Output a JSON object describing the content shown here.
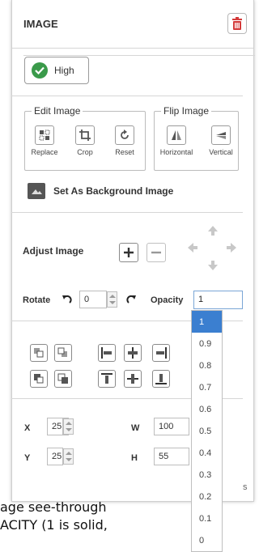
{
  "panel": {
    "title": "IMAGE",
    "delete_icon": "trash-icon"
  },
  "quality": {
    "label": "High",
    "icon": "check-circle-icon",
    "accent": "#3a9a4a"
  },
  "edit_image": {
    "legend": "Edit Image",
    "tools": [
      {
        "label": "Replace",
        "icon": "replace-icon"
      },
      {
        "label": "Crop",
        "icon": "crop-icon"
      },
      {
        "label": "Reset",
        "icon": "reset-icon"
      }
    ]
  },
  "flip_image": {
    "legend": "Flip Image",
    "tools": [
      {
        "label": "Horizontal",
        "icon": "flip-horizontal-icon"
      },
      {
        "label": "Vertical",
        "icon": "flip-vertical-icon"
      }
    ]
  },
  "background": {
    "label": "Set As Background Image",
    "icon": "image-icon"
  },
  "adjust": {
    "label": "Adjust Image",
    "zoom_in": "+",
    "zoom_out": "−"
  },
  "rotate": {
    "label": "Rotate",
    "value": "0"
  },
  "opacity": {
    "label": "Opacity",
    "value": "1",
    "options": [
      "1",
      "0.9",
      "0.8",
      "0.7",
      "0.6",
      "0.5",
      "0.4",
      "0.3",
      "0.2",
      "0.1",
      "0"
    ],
    "selected_color": "#3b7fd0"
  },
  "position": {
    "x_label": "X",
    "x_value": "25",
    "y_label": "Y",
    "y_value": "25",
    "w_label": "W",
    "w_value": "100",
    "h_label": "H",
    "h_value": "55"
  },
  "footer": {
    "line1": "age see-through",
    "line2": "ACITY (1 is solid,",
    "line3": "s"
  }
}
